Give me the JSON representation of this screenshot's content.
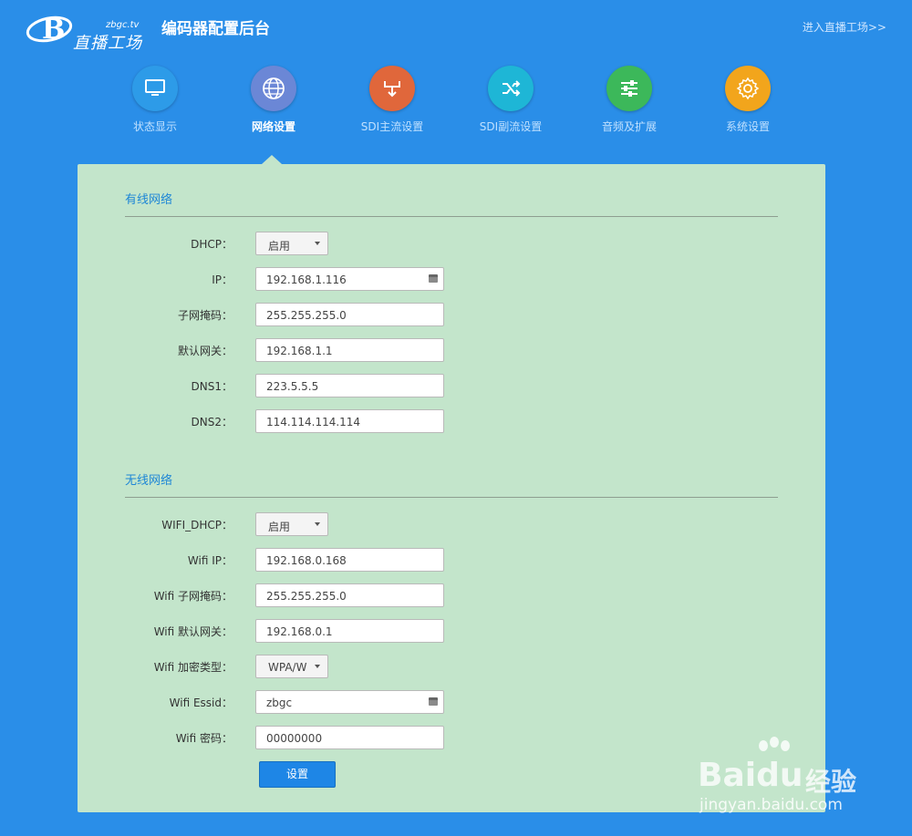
{
  "header": {
    "logo_subtitle": "zbgc.tv",
    "logo_text": "直播工场",
    "title": "编码器配置后台",
    "external_link": "进入直播工场>>"
  },
  "nav": {
    "items": [
      {
        "label": "状态显示",
        "icon": "monitor-icon",
        "color": "#2d9be8"
      },
      {
        "label": "网络设置",
        "icon": "globe-icon",
        "color": "#6b87d6"
      },
      {
        "label": "SDI主流设置",
        "icon": "download-arrow-icon",
        "color": "#e0673b"
      },
      {
        "label": "SDI副流设置",
        "icon": "shuffle-icon",
        "color": "#1eb6d6"
      },
      {
        "label": "音频及扩展",
        "icon": "sliders-icon",
        "color": "#3cb85a"
      },
      {
        "label": "系统设置",
        "icon": "gear-icon",
        "color": "#f2a51c"
      }
    ],
    "active_index": 1
  },
  "wired": {
    "section_title": "有线网络",
    "dhcp": {
      "label": "DHCP：",
      "value": "启用"
    },
    "ip": {
      "label": "IP：",
      "value": "192.168.1.116"
    },
    "subnet": {
      "label": "子网掩码：",
      "value": "255.255.255.0"
    },
    "gateway": {
      "label": "默认网关：",
      "value": "192.168.1.1"
    },
    "dns1": {
      "label": "DNS1：",
      "value": "223.5.5.5"
    },
    "dns2": {
      "label": "DNS2：",
      "value": "114.114.114.114"
    }
  },
  "wireless": {
    "section_title": "无线网络",
    "dhcp": {
      "label": "WIFI_DHCP：",
      "value": "启用"
    },
    "ip": {
      "label": "Wifi IP：",
      "value": "192.168.0.168"
    },
    "subnet": {
      "label": "Wifi 子网掩码：",
      "value": "255.255.255.0"
    },
    "gateway": {
      "label": "Wifi 默认网关：",
      "value": "192.168.0.1"
    },
    "encryption": {
      "label": "Wifi 加密类型：",
      "value": "WPA/W"
    },
    "essid": {
      "label": "Wifi Essid：",
      "value": "zbgc"
    },
    "password": {
      "label": "Wifi 密码：",
      "value": "00000000"
    }
  },
  "submit_label": "设置",
  "watermark": {
    "brand": "Bai",
    "brand2": "du",
    "cn": "经验",
    "url": "jingyan.baidu.com"
  }
}
